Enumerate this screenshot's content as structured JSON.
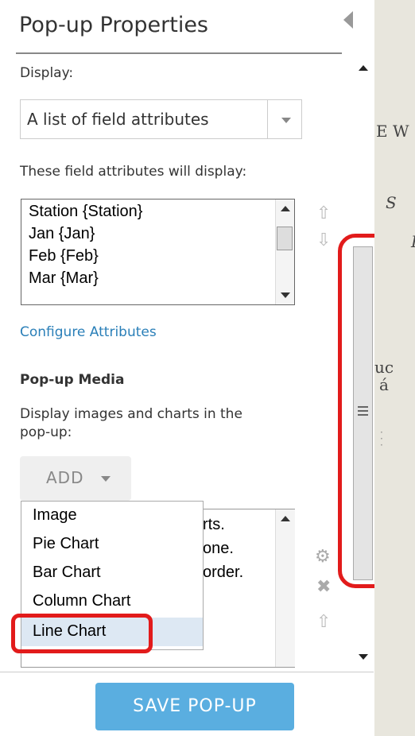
{
  "panel": {
    "title": "Pop-up Properties",
    "display_label": "Display:",
    "display_value": "A list of field attributes",
    "attributes_label": "These field attributes will display:",
    "attributes": [
      "Station {Station}",
      "Jan {Jan}",
      "Feb {Feb}",
      "Mar {Mar}"
    ],
    "configure_link": "Configure Attributes",
    "media_heading": "Pop-up Media",
    "media_desc_line1": "Display images and charts in the",
    "media_desc_line2": "pop-up:",
    "add_button": "ADD",
    "media_box_lines": [
      "rts.",
      "one.",
      "order."
    ],
    "add_menu": [
      "Image",
      "Pie Chart",
      "Bar Chart",
      "Column Chart",
      "Line Chart"
    ],
    "selected_menu_item": "Line Chart",
    "save_button": "SAVE POP-UP"
  },
  "map_labels": [
    "E W",
    "S",
    "I",
    "uc",
    "á"
  ],
  "colors": {
    "accent": "#5aaee0",
    "link": "#2a7fb8",
    "highlight_outline": "#e21b1b",
    "selected_item": "#dde8f3"
  }
}
